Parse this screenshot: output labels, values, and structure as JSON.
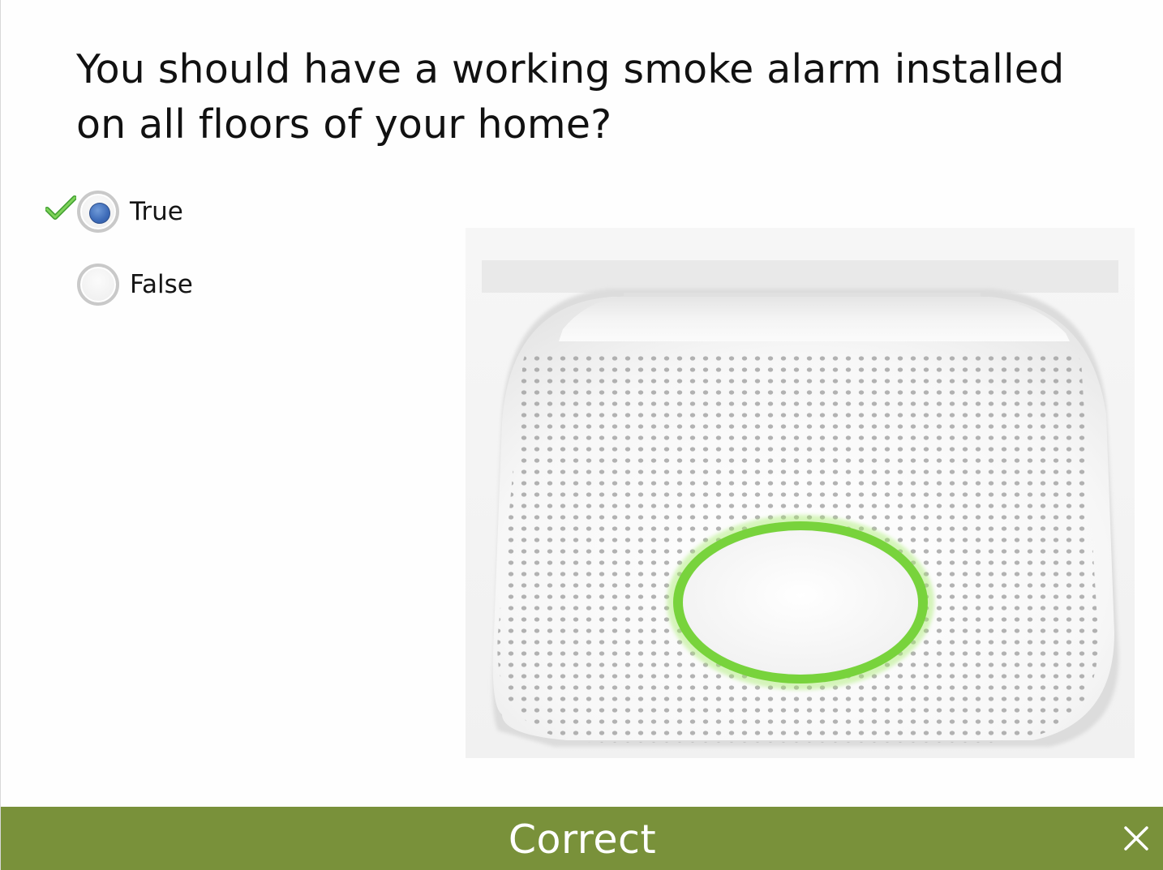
{
  "question": {
    "text": "You should have a working smoke alarm installed on all floors of your home?"
  },
  "choices": [
    {
      "label": "True",
      "selected": true,
      "correct": true
    },
    {
      "label": "False",
      "selected": false,
      "correct": false
    }
  ],
  "image": {
    "subject": "smoke-alarm-photo"
  },
  "feedback": {
    "label": "Correct",
    "color": "#79913a"
  },
  "icons": {
    "correct_mark": "check-icon",
    "close": "close-icon"
  },
  "colors": {
    "selected_radio": "#3d6bb8",
    "check_mark": "#4caf36",
    "ring_glow": "#8fe04a"
  }
}
